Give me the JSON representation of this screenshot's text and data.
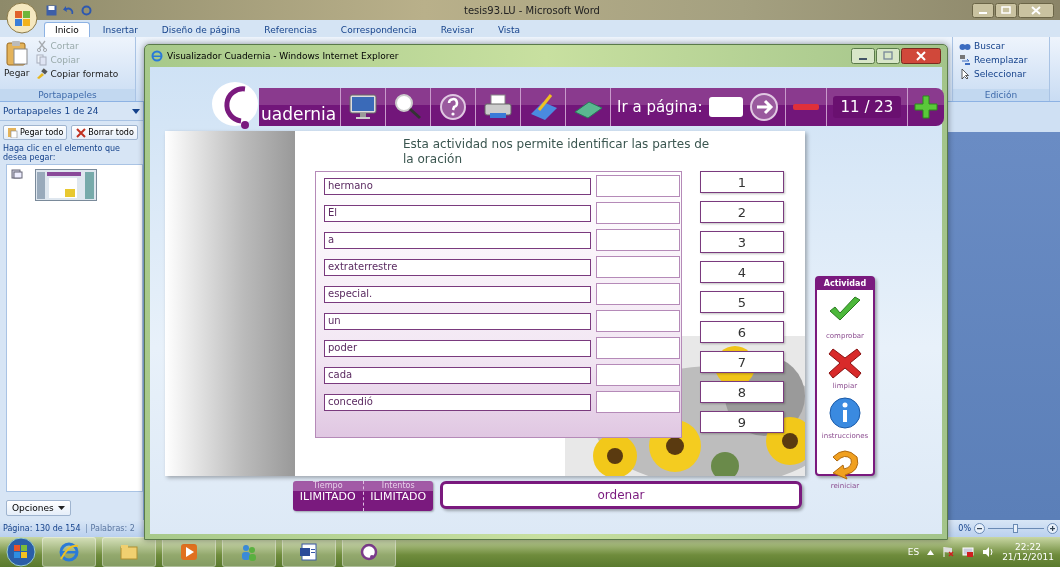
{
  "word": {
    "title": "tesis93.LU - Microsoft Word",
    "tabs": [
      {
        "label": "Inicio",
        "selected": true
      },
      {
        "label": "Insertar",
        "selected": false
      },
      {
        "label": "Diseño de página",
        "selected": false
      },
      {
        "label": "Referencias",
        "selected": false
      },
      {
        "label": "Correspondencia",
        "selected": false
      },
      {
        "label": "Revisar",
        "selected": false
      },
      {
        "label": "Vista",
        "selected": false
      }
    ],
    "clipboard_group": {
      "paste": "Pegar",
      "items": [
        {
          "label": "Cortar",
          "disabled": true
        },
        {
          "label": "Copiar",
          "disabled": true
        },
        {
          "label": "Copiar formato",
          "disabled": false
        }
      ],
      "group": "Portapapeles"
    },
    "editing_group": {
      "items": [
        "Buscar",
        "Reemplazar",
        "Seleccionar"
      ],
      "group": "Edición"
    },
    "clipboard_pane": {
      "title": "Portapapeles 1 de 24",
      "buttons": [
        "Pegar todo",
        "Borrar todo"
      ],
      "hint": "Haga clic en el elemento que desea pegar:",
      "options": "Opciones"
    },
    "status_bar": {
      "page": "Página: 130 de 154",
      "words": "Palabras: 2",
      "zoom": "0%",
      "zoom_slider": {
        "level": 0.5
      }
    }
  },
  "browser": {
    "title": "Visualizador Cuadernia - Windows Internet Explorer",
    "toolbar": {
      "logo": "uadernia",
      "goto_label": "Ir a página:",
      "page": "11 / 23"
    },
    "activity": {
      "instruction": "Esta actividad nos permite identificar las partes de la oración",
      "words": [
        "hermano",
        "El",
        "a",
        "extraterrestre",
        "especial.",
        "un",
        "poder",
        "cada",
        "concedió"
      ],
      "numbers": [
        "1",
        "2",
        "3",
        "4",
        "5",
        "6",
        "7",
        "8",
        "9"
      ]
    },
    "actions": {
      "title": "Actividad",
      "items": [
        {
          "kind": "check",
          "label": "comprobar"
        },
        {
          "kind": "clear",
          "label": "limpiar"
        },
        {
          "kind": "info",
          "label": "instrucciones"
        },
        {
          "kind": "restart",
          "label": "reiniciar"
        }
      ]
    },
    "footer": {
      "time_label": "Tiempo",
      "time": "ILIMITADO",
      "tries_label": "Intentos",
      "tries": "ILIMITADO",
      "mode": "ordenar"
    }
  },
  "taskbar": {
    "language": "ES",
    "time": "22:22",
    "date": "21/12/2011"
  }
}
